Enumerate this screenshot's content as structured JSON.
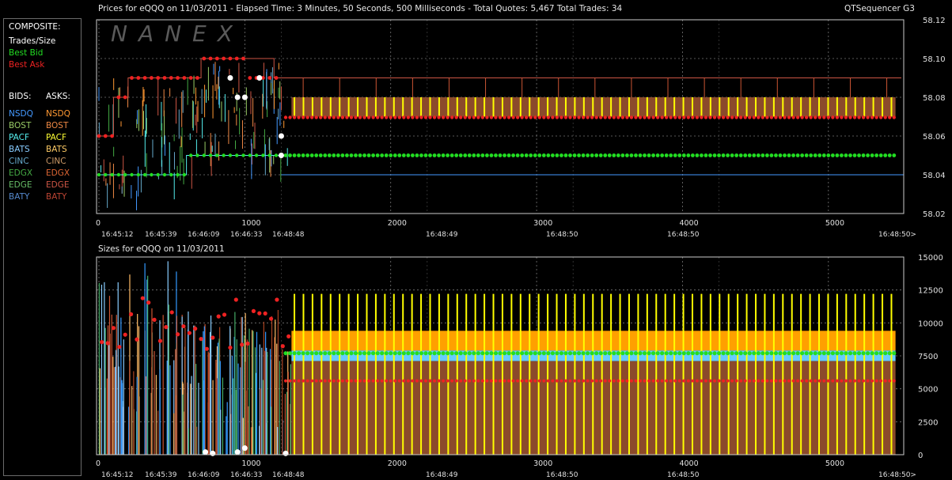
{
  "header": {
    "title": "Prices for  eQQQ  on  11/03/2011  -  Elapsed Time: 3 Minutes, 50 Seconds, 500 Milliseconds  -  Total Quotes: 5,467  Total Trades: 34",
    "app_name": "QTSequencer G3",
    "sizes_title": "Sizes for  eQQQ  on  11/03/2011"
  },
  "watermark": "NANEX",
  "legend": {
    "composite_label": "COMPOSITE:",
    "composite_items": [
      {
        "label": "Trades/Size",
        "color": "#ffffff"
      },
      {
        "label": "Best Bid",
        "color": "#22dd22"
      },
      {
        "label": "Best Ask",
        "color": "#ee2222"
      }
    ],
    "bids_label": "BIDS:",
    "asks_label": "ASKS:",
    "exchanges": [
      {
        "bid": "NSDQ",
        "ask": "NSDQ",
        "bid_color": "#4499ff",
        "ask_color": "#ff9933"
      },
      {
        "bid": "BOST",
        "ask": "BOST",
        "bid_color": "#99cc66",
        "ask_color": "#ee8844"
      },
      {
        "bid": "PACF",
        "ask": "PACF",
        "bid_color": "#55eeee",
        "ask_color": "#ffff33"
      },
      {
        "bid": "BATS",
        "ask": "BATS",
        "bid_color": "#88ccff",
        "ask_color": "#ffcc66"
      },
      {
        "bid": "CINC",
        "ask": "CINC",
        "bid_color": "#66aacc",
        "ask_color": "#cc9966"
      },
      {
        "bid": "EDGX",
        "ask": "EDGX",
        "bid_color": "#44aa44",
        "ask_color": "#dd6633"
      },
      {
        "bid": "EDGE",
        "ask": "EDGE",
        "bid_color": "#66bb66",
        "ask_color": "#cc5544"
      },
      {
        "bid": "BATY",
        "ask": "BATY",
        "bid_color": "#5588cc",
        "ask_color": "#bb4433"
      }
    ]
  },
  "chart_data": [
    {
      "type": "line",
      "name": "Prices",
      "ylim": [
        58.02,
        58.12
      ],
      "y_ticks": [
        "58.12",
        "58.10",
        "58.08",
        "58.06",
        "58.04",
        "58.02"
      ],
      "xlim": [
        0,
        5500
      ],
      "x_ticks": [
        "0",
        "1000",
        "2000",
        "3000",
        "4000",
        "5000"
      ],
      "time_labels": [
        "16:45:12",
        "16:45:39",
        "16:46:09",
        "16:46:33",
        "16:48:48",
        "16:48:49",
        "16:48:50",
        "16:48:50",
        "16:48:50>"
      ],
      "best_bid": {
        "x": [
          0,
          300,
          600,
          1000,
          1250,
          5500
        ],
        "y": [
          58.04,
          58.04,
          58.05,
          58.05,
          58.05,
          58.05
        ]
      },
      "best_ask": {
        "x": [
          0,
          100,
          200,
          400,
          800,
          1000,
          1250,
          5500
        ],
        "y": [
          58.06,
          58.08,
          58.09,
          58.08,
          58.1,
          58.09,
          58.07,
          58.07
        ]
      },
      "trades": {
        "x": [
          900,
          950,
          1000,
          1100,
          1250,
          1250
        ],
        "y": [
          58.09,
          58.08,
          58.08,
          58.09,
          58.06,
          58.05
        ]
      }
    },
    {
      "type": "bar",
      "name": "Sizes",
      "ylim": [
        0,
        15000
      ],
      "y_ticks": [
        "15000",
        "12500",
        "10000",
        "7500",
        "5000",
        "2500",
        "0"
      ],
      "xlim": [
        0,
        5500
      ],
      "x_ticks": [
        "0",
        "1000",
        "2000",
        "3000",
        "4000",
        "5000"
      ],
      "time_labels": [
        "16:45:12",
        "16:45:39",
        "16:46:09",
        "16:46:33",
        "16:48:48",
        "16:48:49",
        "16:48:50",
        "16:48:50",
        "16:48:50>"
      ],
      "bid_size_level": 7700,
      "ask_size_level": 5600,
      "trade_sizes": {
        "x": [
          730,
          780,
          950,
          1000,
          1280
        ],
        "y": [
          200,
          100,
          200,
          500,
          100
        ]
      }
    }
  ],
  "colors": {
    "grid": "#777777",
    "axis": "#cccccc",
    "bid": "#22dd22",
    "ask": "#ee2222",
    "yellow": "#ffff00",
    "brown": "#8b4a2b",
    "orange": "#ffa000"
  }
}
